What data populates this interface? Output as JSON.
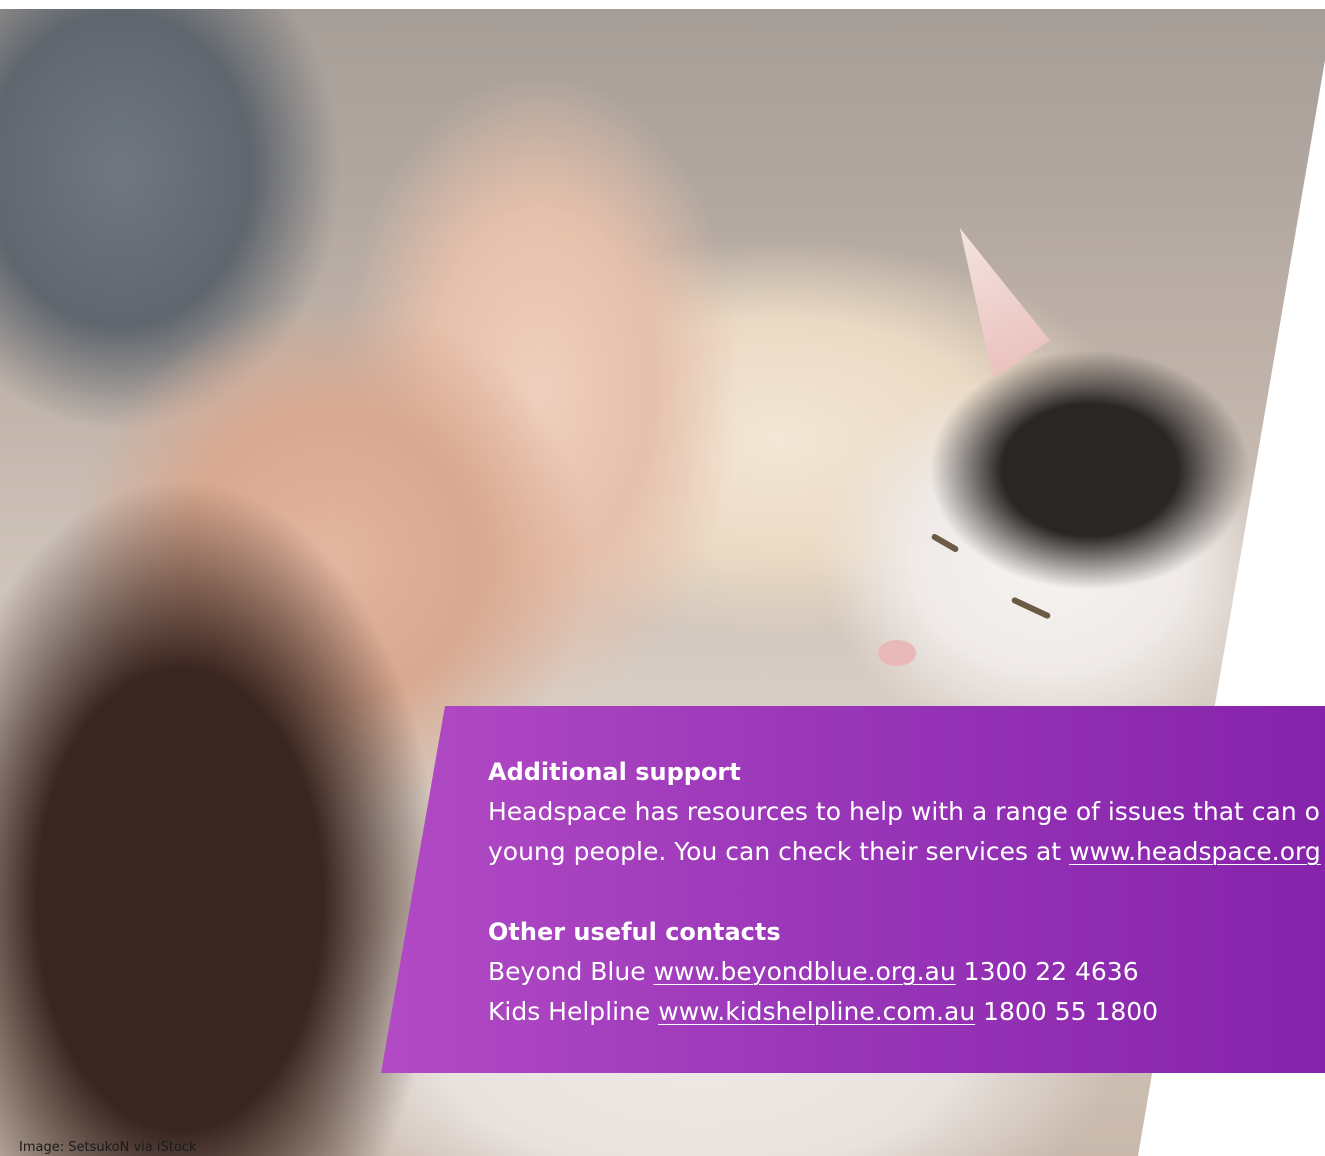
{
  "photo": {
    "subject": "woman-and-cat-photo"
  },
  "additional_support": {
    "heading": "Additional support",
    "line1": "Headspace has resources to help with a range of issues that can o",
    "line2_prefix": "young people. You can check their services at ",
    "line2_link": "www.headspace.org"
  },
  "other_contacts": {
    "heading": "Other useful contacts",
    "items": [
      {
        "name": "Beyond Blue",
        "link": "www.beyondblue.org.au",
        "phone": "1300 22 4636"
      },
      {
        "name": "Kids Helpline",
        "link": "www.kidshelpline.com.au",
        "phone": "1800 55 1800"
      }
    ]
  },
  "credit": "Image: SetsukoN via iStock",
  "colors": {
    "panel_start": "#b24ac4",
    "panel_end": "#8623ab",
    "text": "#ffffff"
  }
}
